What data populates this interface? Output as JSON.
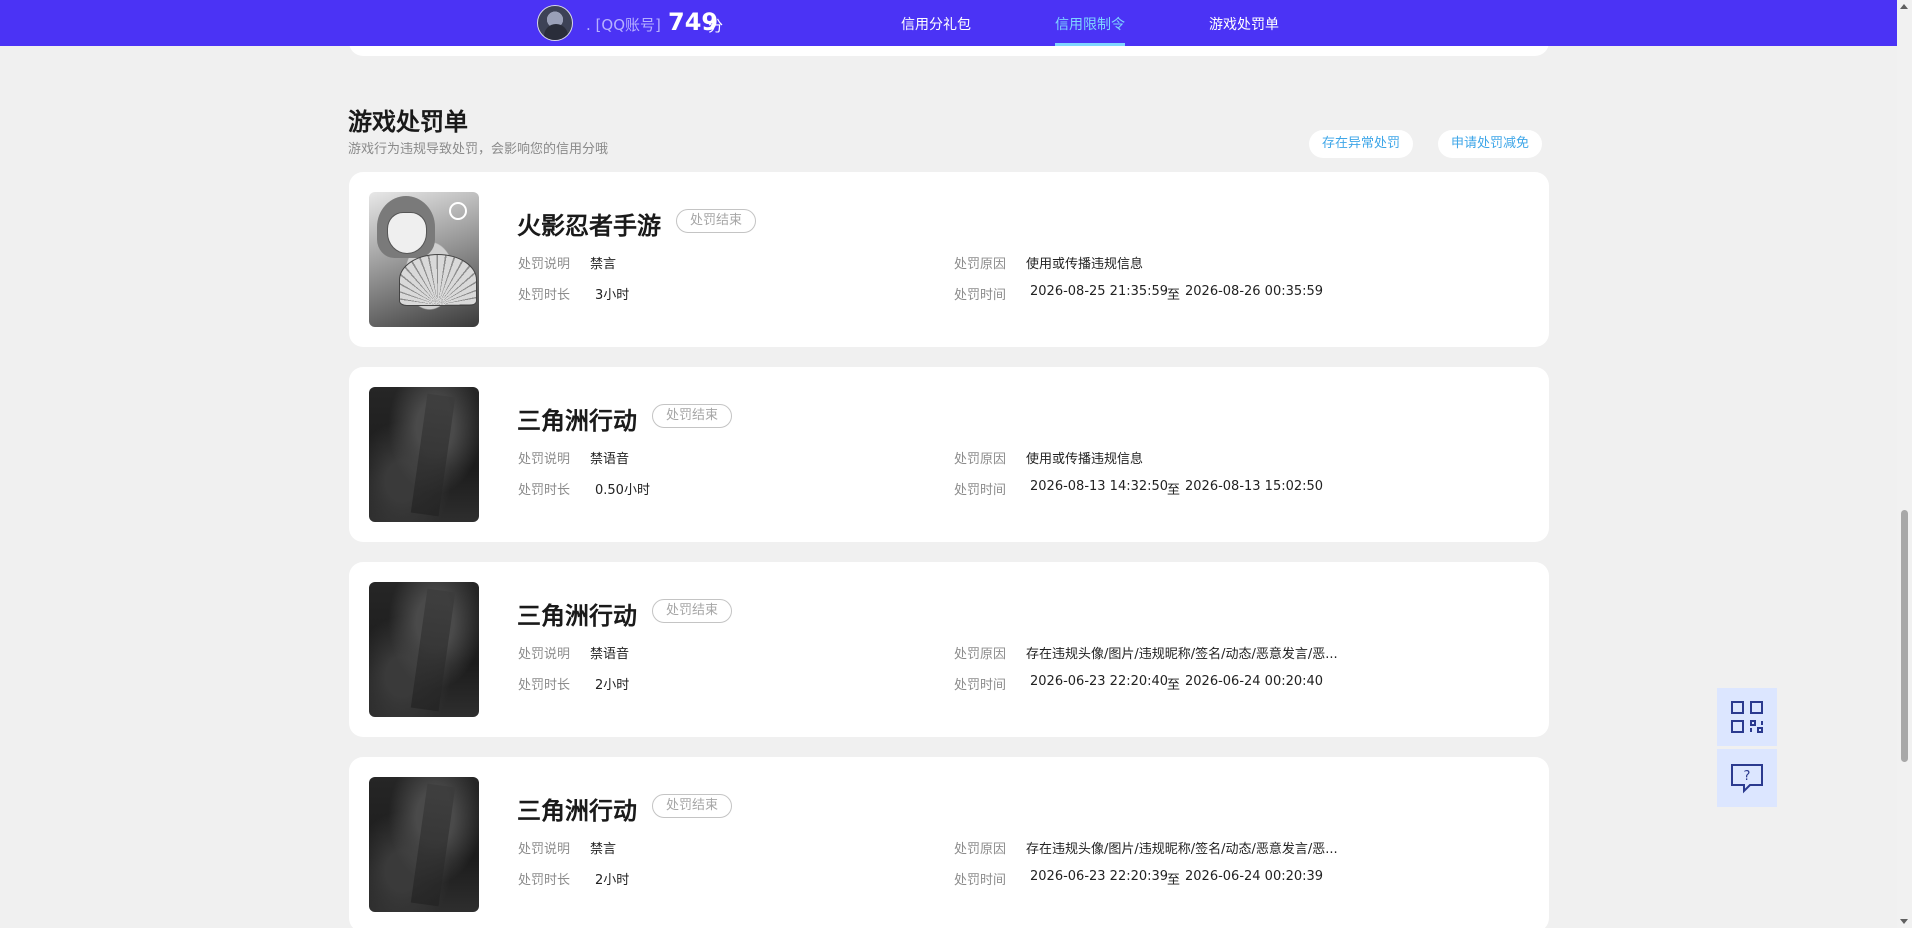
{
  "header": {
    "account_label": ". [QQ账号]",
    "score": "749",
    "score_unit": "分",
    "tabs": [
      {
        "label": "信用分礼包",
        "active": false
      },
      {
        "label": "信用限制令",
        "active": true
      },
      {
        "label": "游戏处罚单",
        "active": false
      }
    ]
  },
  "section": {
    "title": "游戏处罚单",
    "subtitle": "游戏行为违规导致处罚，会影响您的信用分哦",
    "report_button": "存在异常处罚",
    "appeal_button": "申请处罚减免"
  },
  "labels": {
    "desc": "处罚说明",
    "duration": "处罚时长",
    "reason": "处罚原因",
    "time": "处罚时间",
    "to": "至"
  },
  "penalties": [
    {
      "game": "火影忍者手游",
      "status": "处罚结束",
      "desc": "禁言",
      "duration": "3小时",
      "reason": "使用或传播违规信息",
      "start": "2026-08-25 21:35:59",
      "end": "2026-08-26 00:35:59"
    },
    {
      "game": "三角洲行动",
      "status": "处罚结束",
      "desc": "禁语音",
      "duration": "0.50小时",
      "reason": "使用或传播违规信息",
      "start": "2026-08-13 14:32:50",
      "end": "2026-08-13 15:02:50"
    },
    {
      "game": "三角洲行动",
      "status": "处罚结束",
      "desc": "禁语音",
      "duration": "2小时",
      "reason": "存在违规头像/图片/违规昵称/签名/动态/恶意发言/恶...",
      "start": "2026-06-23 22:20:40",
      "end": "2026-06-24 00:20:40"
    },
    {
      "game": "三角洲行动",
      "status": "处罚结束",
      "desc": "禁言",
      "duration": "2小时",
      "reason": "存在违规头像/图片/违规昵称/签名/动态/恶意发言/恶...",
      "start": "2026-06-23 22:20:39",
      "end": "2026-06-24 00:20:39"
    }
  ],
  "floating": {
    "qr_icon": "qr-code-icon",
    "help_icon": "help-chat-icon"
  },
  "colors": {
    "header_bg": "#4b33f5",
    "active_tab": "#7fd6ff",
    "link_blue": "#3ea6e8"
  }
}
